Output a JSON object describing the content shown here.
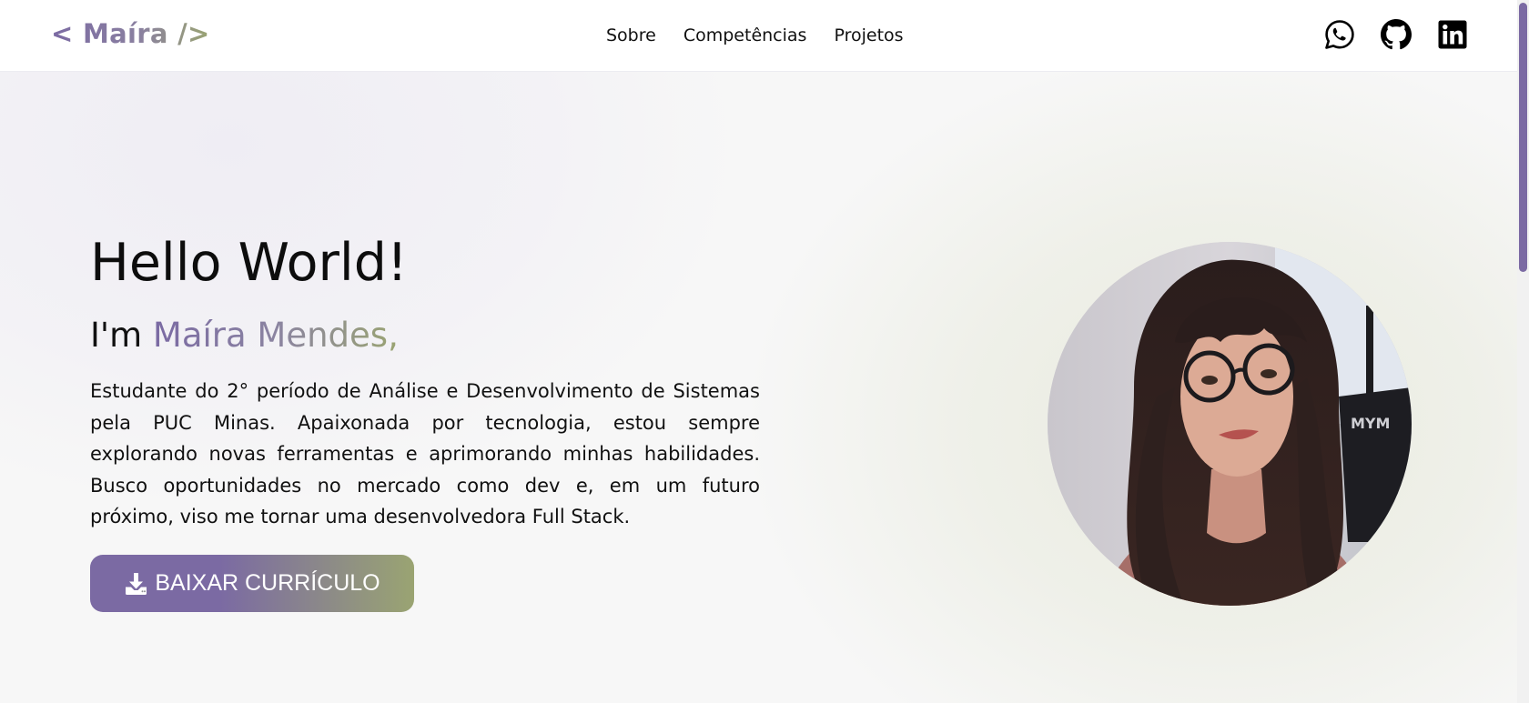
{
  "header": {
    "logo": "< Maíra />",
    "nav": [
      {
        "label": "Sobre"
      },
      {
        "label": "Competências"
      },
      {
        "label": "Projetos"
      }
    ],
    "social_icons": [
      "whatsapp-icon",
      "github-icon",
      "linkedin-icon"
    ]
  },
  "hero": {
    "greeting": "Hello World!",
    "intro_prefix": "I'm ",
    "name": "Maíra Mendes,",
    "bio": "Estudante do 2° período de Análise e Desenvolvimento de Sistemas pela PUC Minas. Apaixonada por tecnologia, estou sempre explorando novas ferramentas e aprimorando minhas habilidades. Busco oportunidades no mercado como dev e, em um futuro próximo, viso me tornar uma desenvolvedora Full Stack.",
    "cta_label": "BAIXAR CURRÍCULO",
    "cta_icon": "download-icon",
    "photo": "profile-photo"
  },
  "colors": {
    "accent_purple": "#7b6aa3",
    "accent_olive": "#9aa472",
    "text": "#111111",
    "background": "#f7f7f7"
  }
}
